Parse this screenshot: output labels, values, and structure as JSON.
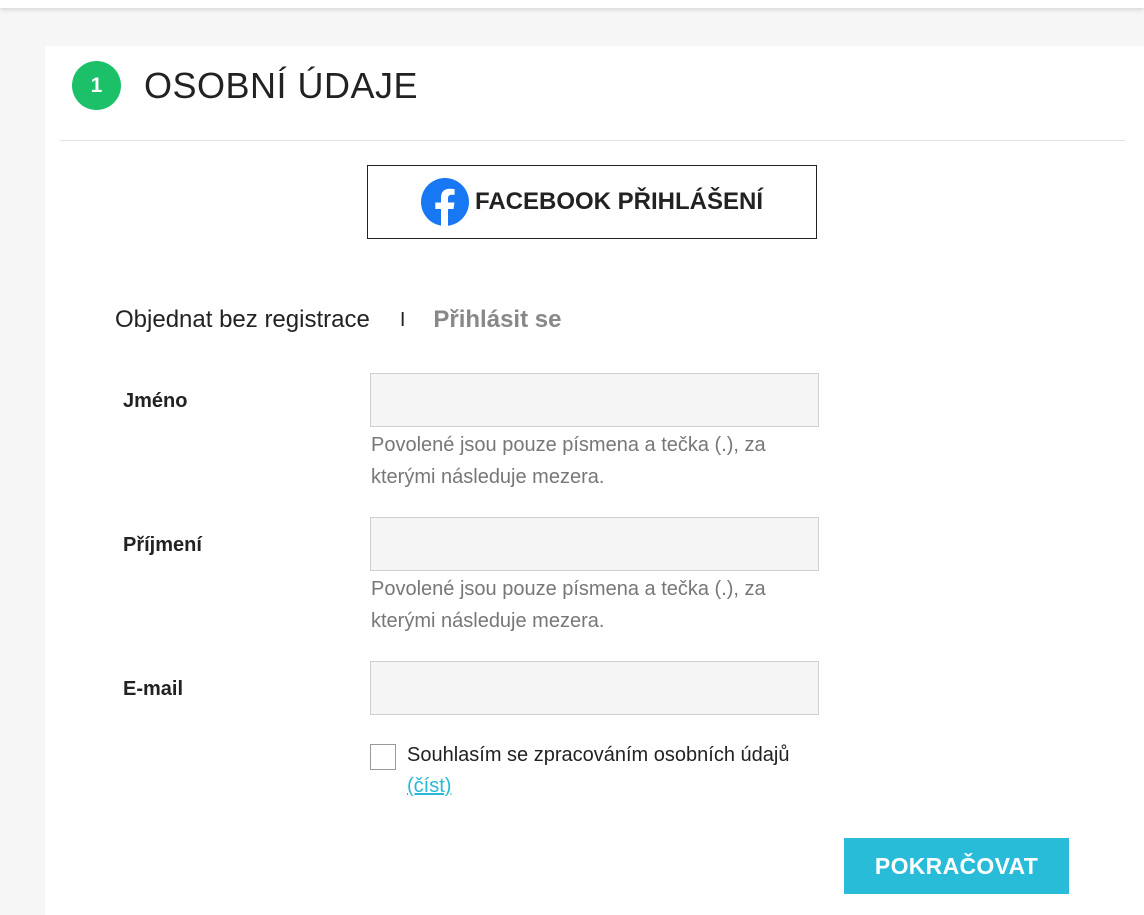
{
  "header": {
    "step_number": "1",
    "title": "OSOBNÍ ÚDAJE",
    "step_color": "#1cc069"
  },
  "facebook_login": {
    "label": "FACEBOOK PŘIHLÁŠENÍ",
    "icon": "facebook-icon",
    "icon_color": "#1877f2"
  },
  "tabs": {
    "guest_label": "Objednat bez registrace",
    "separator": "I",
    "login_label": "Přihlásit se",
    "active": "guest"
  },
  "form": {
    "first_name": {
      "label": "Jméno",
      "value": "",
      "hint": "Povolené jsou pouze písmena a tečka (.), za kterými následuje mezera."
    },
    "last_name": {
      "label": "Příjmení",
      "value": "",
      "hint": "Povolené jsou pouze písmena a tečka (.), za kterými následuje mezera."
    },
    "email": {
      "label": "E-mail",
      "value": ""
    },
    "consent": {
      "text": "Souhlasím se zpracováním osobních údajů",
      "link_text": "(číst)",
      "checked": false
    }
  },
  "actions": {
    "continue_label": "POKRAČOVAT",
    "continue_color": "#29bcd9"
  }
}
